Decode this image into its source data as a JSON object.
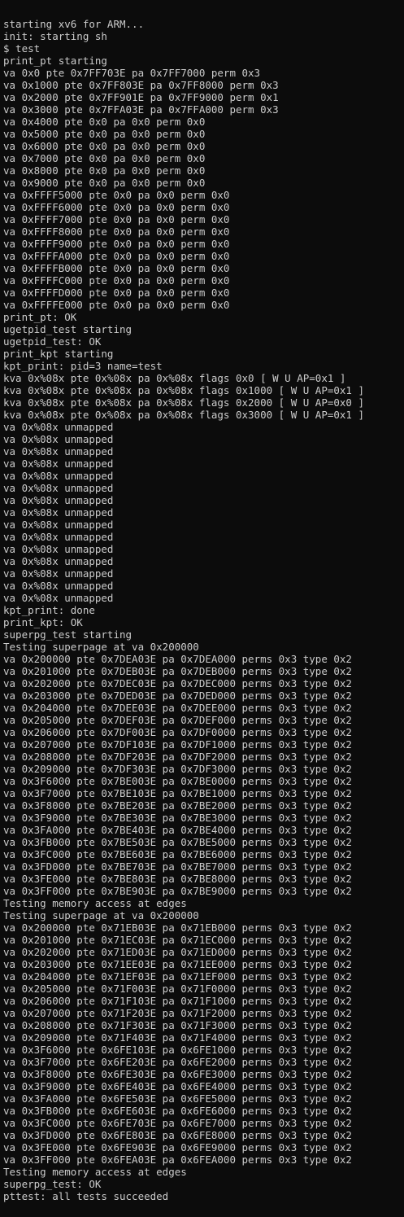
{
  "terminal": {
    "lines": [
      "starting xv6 for ARM...",
      "init: starting sh",
      "$ test",
      "print_pt starting",
      "va 0x0 pte 0x7FF703E pa 0x7FF7000 perm 0x3",
      "va 0x1000 pte 0x7FF803E pa 0x7FF8000 perm 0x3",
      "va 0x2000 pte 0x7FF901E pa 0x7FF9000 perm 0x1",
      "va 0x3000 pte 0x7FFA03E pa 0x7FFA000 perm 0x3",
      "va 0x4000 pte 0x0 pa 0x0 perm 0x0",
      "va 0x5000 pte 0x0 pa 0x0 perm 0x0",
      "va 0x6000 pte 0x0 pa 0x0 perm 0x0",
      "va 0x7000 pte 0x0 pa 0x0 perm 0x0",
      "va 0x8000 pte 0x0 pa 0x0 perm 0x0",
      "va 0x9000 pte 0x0 pa 0x0 perm 0x0",
      "va 0xFFFF5000 pte 0x0 pa 0x0 perm 0x0",
      "va 0xFFFF6000 pte 0x0 pa 0x0 perm 0x0",
      "va 0xFFFF7000 pte 0x0 pa 0x0 perm 0x0",
      "va 0xFFFF8000 pte 0x0 pa 0x0 perm 0x0",
      "va 0xFFFF9000 pte 0x0 pa 0x0 perm 0x0",
      "va 0xFFFFA000 pte 0x0 pa 0x0 perm 0x0",
      "va 0xFFFFB000 pte 0x0 pa 0x0 perm 0x0",
      "va 0xFFFFC000 pte 0x0 pa 0x0 perm 0x0",
      "va 0xFFFFD000 pte 0x0 pa 0x0 perm 0x0",
      "va 0xFFFFE000 pte 0x0 pa 0x0 perm 0x0",
      "print_pt: OK",
      "ugetpid_test starting",
      "ugetpid_test: OK",
      "print_kpt starting",
      "kpt_print: pid=3 name=test",
      "kva 0x%08x pte 0x%08x pa 0x%08x flags 0x0 [ W U AP=0x1 ]",
      "kva 0x%08x pte 0x%08x pa 0x%08x flags 0x1000 [ W U AP=0x1 ]",
      "kva 0x%08x pte 0x%08x pa 0x%08x flags 0x2000 [ W U AP=0x0 ]",
      "kva 0x%08x pte 0x%08x pa 0x%08x flags 0x3000 [ W U AP=0x1 ]",
      "va 0x%08x unmapped",
      "va 0x%08x unmapped",
      "va 0x%08x unmapped",
      "va 0x%08x unmapped",
      "va 0x%08x unmapped",
      "va 0x%08x unmapped",
      "va 0x%08x unmapped",
      "va 0x%08x unmapped",
      "va 0x%08x unmapped",
      "va 0x%08x unmapped",
      "va 0x%08x unmapped",
      "va 0x%08x unmapped",
      "va 0x%08x unmapped",
      "va 0x%08x unmapped",
      "va 0x%08x unmapped",
      "kpt_print: done",
      "print_kpt: OK",
      "superpg_test starting",
      "Testing superpage at va 0x200000",
      "va 0x200000 pte 0x7DEA03E pa 0x7DEA000 perms 0x3 type 0x2",
      "va 0x201000 pte 0x7DEB03E pa 0x7DEB000 perms 0x3 type 0x2",
      "va 0x202000 pte 0x7DEC03E pa 0x7DEC000 perms 0x3 type 0x2",
      "va 0x203000 pte 0x7DED03E pa 0x7DED000 perms 0x3 type 0x2",
      "va 0x204000 pte 0x7DEE03E pa 0x7DEE000 perms 0x3 type 0x2",
      "va 0x205000 pte 0x7DEF03E pa 0x7DEF000 perms 0x3 type 0x2",
      "va 0x206000 pte 0x7DF003E pa 0x7DF0000 perms 0x3 type 0x2",
      "va 0x207000 pte 0x7DF103E pa 0x7DF1000 perms 0x3 type 0x2",
      "va 0x208000 pte 0x7DF203E pa 0x7DF2000 perms 0x3 type 0x2",
      "va 0x209000 pte 0x7DF303E pa 0x7DF3000 perms 0x3 type 0x2",
      "va 0x3F6000 pte 0x7BE003E pa 0x7BE0000 perms 0x3 type 0x2",
      "va 0x3F7000 pte 0x7BE103E pa 0x7BE1000 perms 0x3 type 0x2",
      "va 0x3F8000 pte 0x7BE203E pa 0x7BE2000 perms 0x3 type 0x2",
      "va 0x3F9000 pte 0x7BE303E pa 0x7BE3000 perms 0x3 type 0x2",
      "va 0x3FA000 pte 0x7BE403E pa 0x7BE4000 perms 0x3 type 0x2",
      "va 0x3FB000 pte 0x7BE503E pa 0x7BE5000 perms 0x3 type 0x2",
      "va 0x3FC000 pte 0x7BE603E pa 0x7BE6000 perms 0x3 type 0x2",
      "va 0x3FD000 pte 0x7BE703E pa 0x7BE7000 perms 0x3 type 0x2",
      "va 0x3FE000 pte 0x7BE803E pa 0x7BE8000 perms 0x3 type 0x2",
      "va 0x3FF000 pte 0x7BE903E pa 0x7BE9000 perms 0x3 type 0x2",
      "Testing memory access at edges",
      "Testing superpage at va 0x200000",
      "va 0x200000 pte 0x71EB03E pa 0x71EB000 perms 0x3 type 0x2",
      "va 0x201000 pte 0x71EC03E pa 0x71EC000 perms 0x3 type 0x2",
      "va 0x202000 pte 0x71ED03E pa 0x71ED000 perms 0x3 type 0x2",
      "va 0x203000 pte 0x71EE03E pa 0x71EE000 perms 0x3 type 0x2",
      "va 0x204000 pte 0x71EF03E pa 0x71EF000 perms 0x3 type 0x2",
      "va 0x205000 pte 0x71F003E pa 0x71F0000 perms 0x3 type 0x2",
      "va 0x206000 pte 0x71F103E pa 0x71F1000 perms 0x3 type 0x2",
      "va 0x207000 pte 0x71F203E pa 0x71F2000 perms 0x3 type 0x2",
      "va 0x208000 pte 0x71F303E pa 0x71F3000 perms 0x3 type 0x2",
      "va 0x209000 pte 0x71F403E pa 0x71F4000 perms 0x3 type 0x2",
      "va 0x3F6000 pte 0x6FE103E pa 0x6FE1000 perms 0x3 type 0x2",
      "va 0x3F7000 pte 0x6FE203E pa 0x6FE2000 perms 0x3 type 0x2",
      "va 0x3F8000 pte 0x6FE303E pa 0x6FE3000 perms 0x3 type 0x2",
      "va 0x3F9000 pte 0x6FE403E pa 0x6FE4000 perms 0x3 type 0x2",
      "va 0x3FA000 pte 0x6FE503E pa 0x6FE5000 perms 0x3 type 0x2",
      "va 0x3FB000 pte 0x6FE603E pa 0x6FE6000 perms 0x3 type 0x2",
      "va 0x3FC000 pte 0x6FE703E pa 0x6FE7000 perms 0x3 type 0x2",
      "va 0x3FD000 pte 0x6FE803E pa 0x6FE8000 perms 0x3 type 0x2",
      "va 0x3FE000 pte 0x6FE903E pa 0x6FE9000 perms 0x3 type 0x2",
      "va 0x3FF000 pte 0x6FEA03E pa 0x6FEA000 perms 0x3 type 0x2",
      "Testing memory access at edges",
      "superpg_test: OK",
      "pttest: all tests succeeded"
    ],
    "prompt": "$ ",
    "colors": {
      "background": "#0c0c0c",
      "foreground": "#cccccc"
    }
  }
}
